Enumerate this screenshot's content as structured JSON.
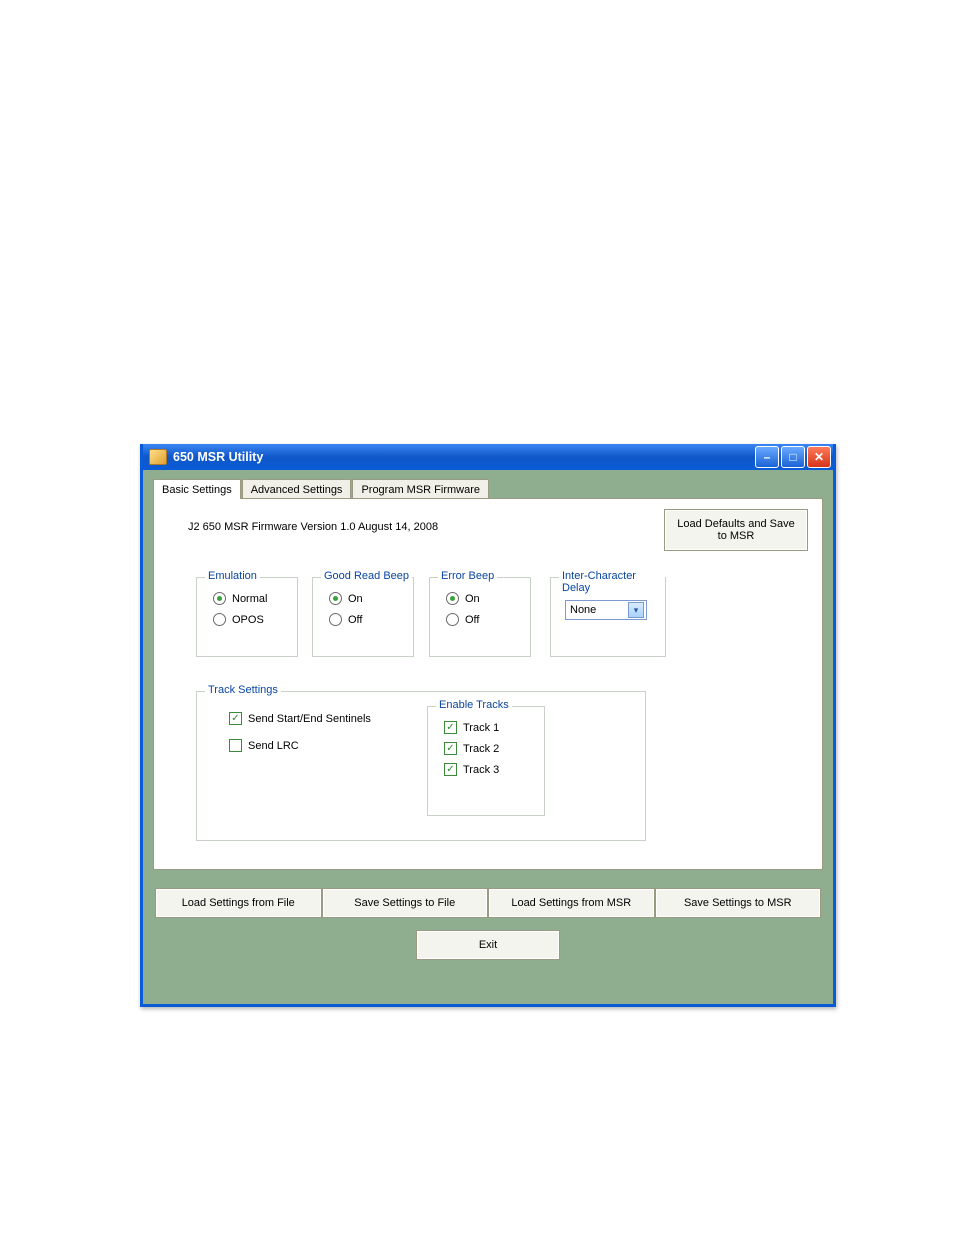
{
  "window": {
    "title": "650 MSR Utility"
  },
  "tabs": [
    {
      "label": "Basic Settings"
    },
    {
      "label": "Advanced Settings"
    },
    {
      "label": "Program MSR Firmware"
    }
  ],
  "version_text": "J2 650 MSR Firmware Version 1.0   August 14, 2008",
  "buttons": {
    "load_defaults": "Load Defaults and Save to MSR",
    "load_file": "Load Settings from File",
    "save_file": "Save Settings to File",
    "load_msr": "Load Settings from MSR",
    "save_msr": "Save Settings to MSR",
    "exit": "Exit"
  },
  "groups": {
    "emulation": {
      "title": "Emulation",
      "opt1": "Normal",
      "opt2": "OPOS",
      "selected": "Normal"
    },
    "good_read": {
      "title": "Good Read Beep",
      "opt1": "On",
      "opt2": "Off",
      "selected": "On"
    },
    "error_beep": {
      "title": "Error Beep",
      "opt1": "On",
      "opt2": "Off",
      "selected": "On"
    },
    "delay": {
      "title": "Inter-Character Delay",
      "value": "None"
    },
    "track_settings": {
      "title": "Track Settings",
      "sentinels": {
        "label": "Send Start/End Sentinels",
        "checked": true
      },
      "lrc": {
        "label": "Send LRC",
        "checked": false
      }
    },
    "enable_tracks": {
      "title": "Enable Tracks",
      "t1": {
        "label": "Track 1",
        "checked": true
      },
      "t2": {
        "label": "Track 2",
        "checked": true
      },
      "t3": {
        "label": "Track 3",
        "checked": true
      }
    }
  }
}
